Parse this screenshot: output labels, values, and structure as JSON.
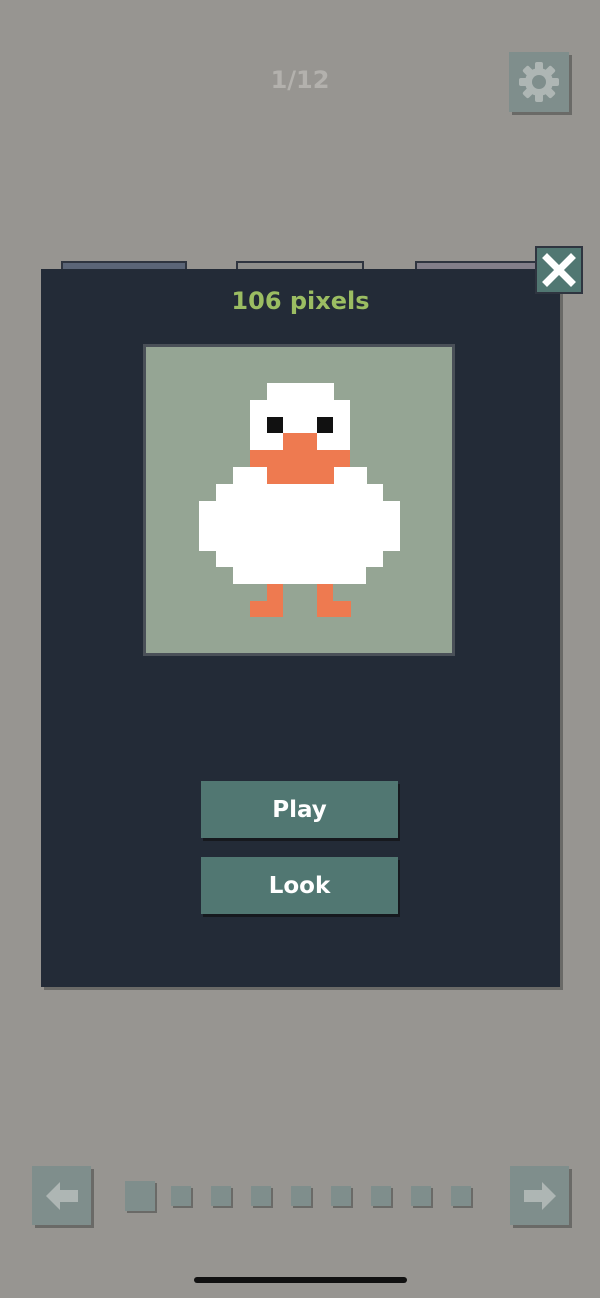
{
  "header": {
    "page_indicator": "1/12",
    "settings_icon": "gear-icon"
  },
  "modal": {
    "title": "106 pixels",
    "preview_subject": "duck",
    "play_label": "Play",
    "look_label": "Look",
    "close_icon": "close-icon"
  },
  "pager": {
    "prev_icon": "arrow-left-icon",
    "next_icon": "arrow-right-icon",
    "visible_dots": 9,
    "active_index": 0
  },
  "colors": {
    "background": "#979591",
    "modal": "#232b37",
    "accent": "#517772",
    "title": "#9bbd62",
    "preview_bg": "#95a594",
    "duck_body": "#ffffff",
    "duck_beak": "#ee7a50",
    "duck_eye": "#111111"
  }
}
